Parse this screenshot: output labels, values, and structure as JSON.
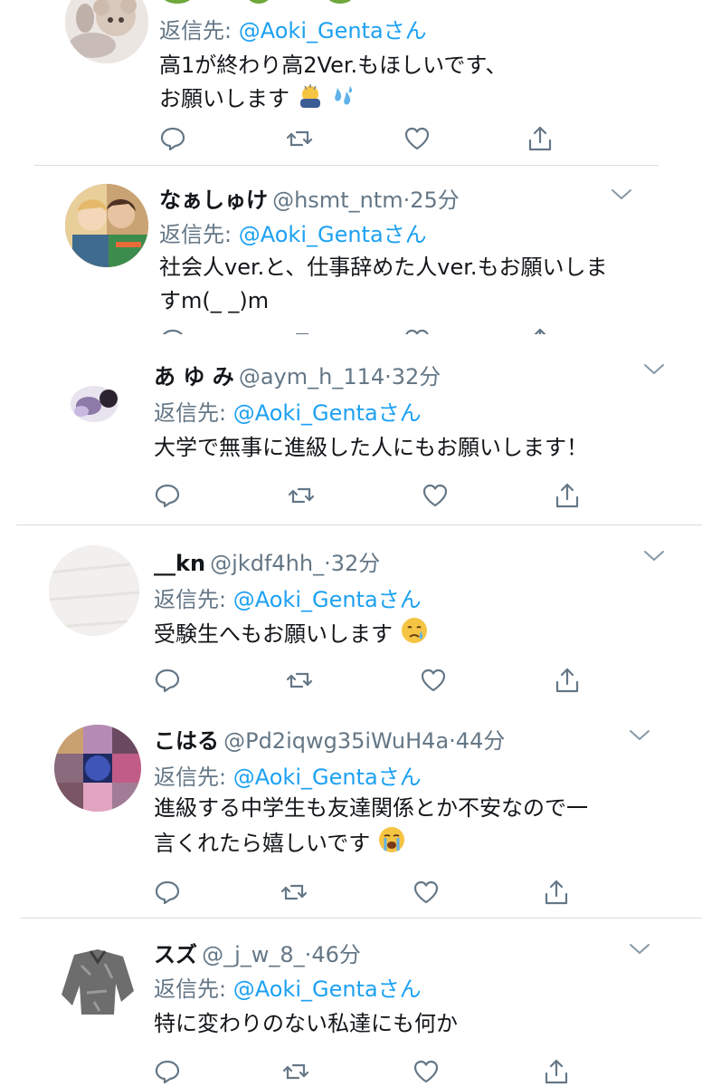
{
  "reply_prefix": "返信先:",
  "reply_suffix": "さん",
  "tweets": [
    {
      "name": "",
      "handle": "",
      "time": "",
      "mention": "@Aoki_Genta",
      "lines": [
        "高1が終わり高2Ver.もほしいです、",
        "お願いします"
      ]
    },
    {
      "name": "なぁしゅけ",
      "handle": "@hsmt_ntm",
      "time": "25分",
      "mention": "@Aoki_Genta",
      "lines": [
        "社会人ver.と、仕事辞めた人ver.もお願いしま",
        "すm(_ _)m"
      ]
    },
    {
      "name": "あ ゆ み",
      "handle": "@aym_h_114",
      "time": "32分",
      "mention": "@Aoki_Genta",
      "lines": [
        "大学で無事に進級した人にもお願いします！"
      ]
    },
    {
      "name": "__kn",
      "handle": "@jkdf4hh_",
      "time": "32分",
      "mention": "@Aoki_Genta",
      "lines": [
        "受験生へもお願いします"
      ]
    },
    {
      "name": "こはる",
      "handle": "@Pd2iqwg35iWuH4a",
      "time": "44分",
      "mention": "@Aoki_Genta",
      "lines": [
        "進級する中学生も友達関係とか不安なので一",
        "言くれたら嬉しいです"
      ]
    },
    {
      "name": "スズ",
      "handle": "@_j_w_8_",
      "time": "46分",
      "mention": "@Aoki_Genta",
      "lines": [
        "特に変わりのない私達にも何か"
      ]
    }
  ],
  "icons": {
    "reply": "reply-icon",
    "retweet": "retweet-icon",
    "like": "heart-icon",
    "share": "share-icon",
    "more": "chevron-down-icon"
  },
  "colors": {
    "mention": "#1da1f2",
    "secondary": "#657786",
    "text": "#14171a",
    "icon": "#657786"
  }
}
